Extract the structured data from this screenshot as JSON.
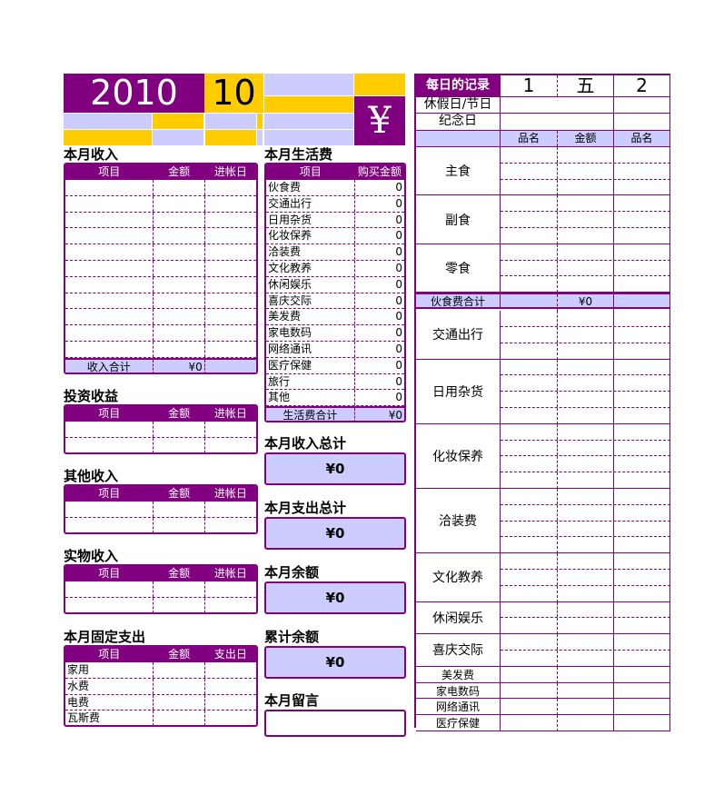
{
  "header": {
    "year": "2010",
    "month": "10",
    "currency_symbol": "¥"
  },
  "colors": {
    "purple": "#800080",
    "gold": "#ffcc00",
    "lavender": "#ccccff"
  },
  "income": {
    "title": "本月收入",
    "columns": [
      "项目",
      "金额",
      "进帐日"
    ],
    "rows": 11,
    "total_label": "收入合计",
    "total_value": "¥0"
  },
  "investment": {
    "title": "投资收益",
    "columns": [
      "项目",
      "金额",
      "进帐日"
    ],
    "rows": 2
  },
  "other_income": {
    "title": "其他收入",
    "columns": [
      "项目",
      "金额",
      "进帐日"
    ],
    "rows": 2
  },
  "in_kind_income": {
    "title": "实物收入",
    "columns": [
      "项目",
      "金额",
      "进帐日"
    ],
    "rows": 2
  },
  "fixed_expense": {
    "title": "本月固定支出",
    "columns": [
      "项目",
      "金额",
      "支出日"
    ],
    "items": [
      "家用",
      "水费",
      "电费",
      "瓦斯费"
    ]
  },
  "living": {
    "title": "本月生活费",
    "columns": [
      "项目",
      "购买金额"
    ],
    "items": [
      {
        "name": "伙食费",
        "amount": "0"
      },
      {
        "name": "交通出行",
        "amount": "0"
      },
      {
        "name": "日用杂货",
        "amount": "0"
      },
      {
        "name": "化妆保养",
        "amount": "0"
      },
      {
        "name": "洽装费",
        "amount": "0"
      },
      {
        "name": "文化教养",
        "amount": "0"
      },
      {
        "name": "休闲娱乐",
        "amount": "0"
      },
      {
        "name": "喜庆交际",
        "amount": "0"
      },
      {
        "name": "美发费",
        "amount": "0"
      },
      {
        "name": "家电数码",
        "amount": "0"
      },
      {
        "name": "网络通讯",
        "amount": "0"
      },
      {
        "name": "医疗保健",
        "amount": "0"
      },
      {
        "name": "旅行",
        "amount": "0"
      },
      {
        "name": "其他",
        "amount": "0"
      }
    ],
    "total_label": "生活费合计",
    "total_value": "¥0"
  },
  "summary": [
    {
      "title": "本月收入总计",
      "value": "¥0"
    },
    {
      "title": "本月支出总计",
      "value": "¥0"
    },
    {
      "title": "本月余额",
      "value": "¥0"
    },
    {
      "title": "累计余额",
      "value": "¥0"
    }
  ],
  "memo": {
    "title": "本月留言",
    "value": ""
  },
  "daily": {
    "title": "每日的记录",
    "day1": "1",
    "weekday1": "五",
    "day2": "2",
    "holiday_label": "休假日/节日",
    "anniversary_label": "纪念日",
    "columns": [
      "品名",
      "金额",
      "品名"
    ],
    "sections": [
      {
        "label": "主食",
        "rows": 3
      },
      {
        "label": "副食",
        "rows": 3
      },
      {
        "label": "零食",
        "rows": 3
      },
      {
        "label": "伙食费合计",
        "rows": 1,
        "total": true,
        "value": "¥0"
      },
      {
        "label": "交通出行",
        "rows": 3
      },
      {
        "label": "日用杂货",
        "rows": 4
      },
      {
        "label": "化妆保养",
        "rows": 4
      },
      {
        "label": "洽装费",
        "rows": 4
      },
      {
        "label": "文化教养",
        "rows": 3
      },
      {
        "label": "休闲娱乐",
        "rows": 2
      },
      {
        "label": "喜庆交际",
        "rows": 2
      },
      {
        "label": "美发费",
        "rows": 1
      },
      {
        "label": "家电数码",
        "rows": 1
      },
      {
        "label": "网络通讯",
        "rows": 1
      },
      {
        "label": "医疗保健",
        "rows": 1
      }
    ]
  }
}
